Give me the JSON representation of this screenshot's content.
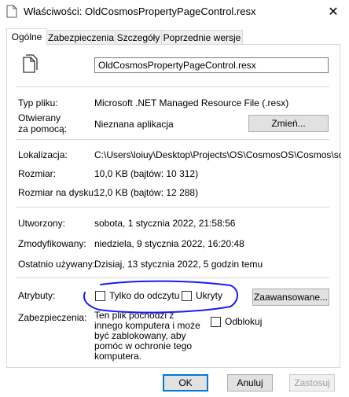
{
  "window": {
    "title": "Właściwości: OldCosmosPropertyPageControl.resx",
    "close_symbol": "✕"
  },
  "tabs": [
    {
      "label": "Ogólne",
      "active": true
    },
    {
      "label": "Zabezpieczenia",
      "active": false
    },
    {
      "label": "Szczegóły",
      "active": false
    },
    {
      "label": "Poprzednie wersje",
      "active": false
    }
  ],
  "general": {
    "file_name": "OldCosmosPropertyPageControl.resx",
    "type_label": "Typ pliku:",
    "type_value": "Microsoft .NET Managed Resource File (.resx)",
    "opens_with_label_1": "Otwierany",
    "opens_with_label_2": "za pomocą:",
    "opens_with_value": "Nieznana aplikacja",
    "change_button": "Zmień...",
    "location_label": "Lokalizacja:",
    "location_value": "C:\\Users\\loiuy\\Desktop\\Projects\\OS\\CosmosOS\\Cosmos\\sour",
    "size_label": "Rozmiar:",
    "size_value": "10,0 KB (bajtów: 10 312)",
    "size_on_disk_label": "Rozmiar na dysku:",
    "size_on_disk_value": "12,0 KB (bajtów: 12 288)",
    "created_label": "Utworzony:",
    "created_value": "sobota, 1 stycznia 2022, 21:58:56",
    "modified_label": "Zmodyfikowany:",
    "modified_value": "niedziela, 9 stycznia 2022, 16:20:48",
    "accessed_label": "Ostatnio używany:",
    "accessed_value": "Dzisiaj, 13 stycznia 2022, 5 godzin temu",
    "attributes_label": "Atrybuty:",
    "readonly_label": "Tylko do odczytu",
    "hidden_label": "Ukryty",
    "advanced_button": "Zaawansowane...",
    "security_label": "Zabezpieczenia:",
    "security_text": "Ten plik pochodzi z innego komputera i może być zablokowany, aby pomóc w ochronie tego komputera.",
    "unblock_label": "Odblokuj"
  },
  "footer": {
    "ok": "OK",
    "cancel": "Anuluj",
    "apply": "Zastosuj"
  },
  "colors": {
    "accent": "#0078d7",
    "annotation": "#1a1aff"
  }
}
